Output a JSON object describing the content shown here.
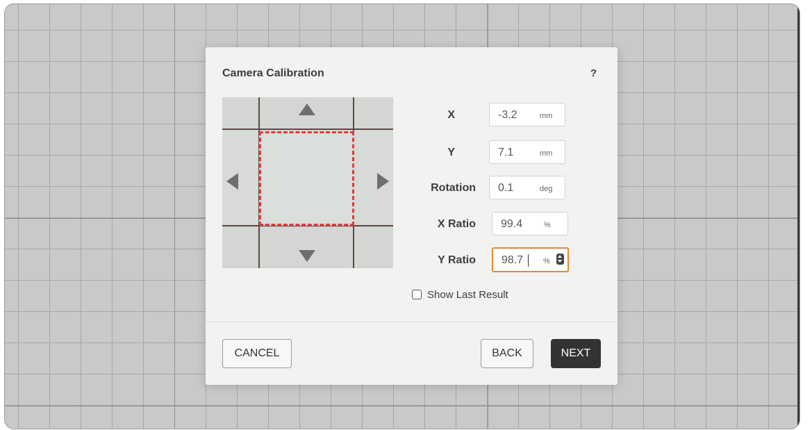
{
  "dialog": {
    "title": "Camera Calibration",
    "help_label": "?",
    "preview": {
      "arrows": [
        "arrow-up-icon",
        "arrow-down-icon",
        "arrow-left-icon",
        "arrow-right-icon"
      ],
      "crosshair_color": "#e43a3a"
    },
    "fields": [
      {
        "label": "X",
        "value": "-3.2",
        "unit": "mm"
      },
      {
        "label": "Y",
        "value": "7.1",
        "unit": "mm"
      },
      {
        "label": "Rotation",
        "value": "0.1",
        "unit": "deg"
      },
      {
        "label": "X Ratio",
        "value": "99.4",
        "unit": "%"
      },
      {
        "label": "Y Ratio",
        "value": "98.7",
        "unit": "%",
        "focused": true,
        "accent": "#e08a36"
      }
    ],
    "show_last_result": {
      "label": "Show Last Result",
      "checked": false
    },
    "buttons": {
      "cancel": "CANCEL",
      "back": "BACK",
      "next": "NEXT"
    }
  }
}
